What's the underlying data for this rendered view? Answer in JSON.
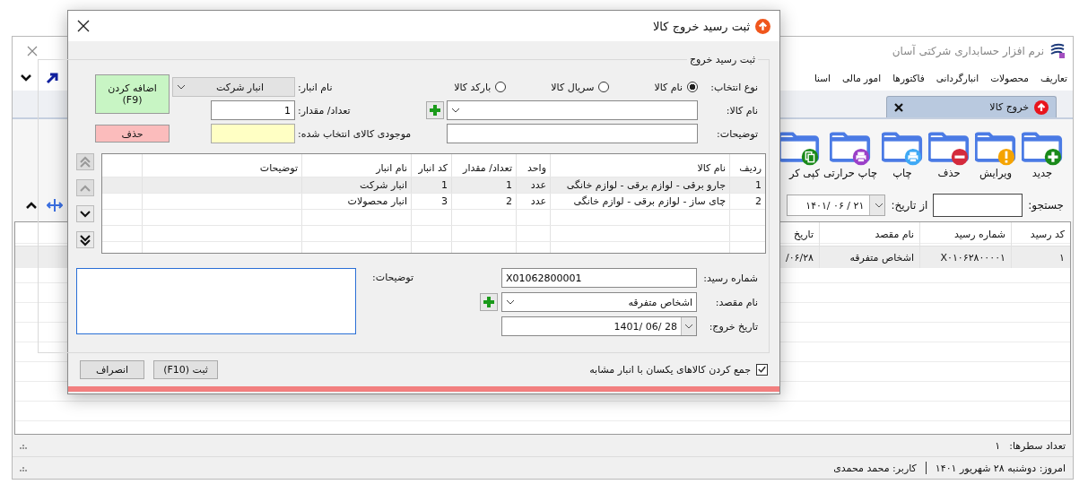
{
  "main_window": {
    "title": "نرم افزار حسابداری شرکتی آسان",
    "menu": [
      "تعاریف",
      "محصولات",
      "انبارگردانی",
      "فاکتورها",
      "امور مالی",
      "اسنا"
    ],
    "tab": {
      "label": "خروج کالا"
    },
    "toolbar": [
      {
        "label": "جدید",
        "kind": "new"
      },
      {
        "label": "ویرایش",
        "kind": "edit"
      },
      {
        "label": "حذف",
        "kind": "delete"
      },
      {
        "label": "چاپ",
        "kind": "print"
      },
      {
        "label": "چاپ حرارتی",
        "kind": "thermal"
      },
      {
        "label": "کپی کر",
        "kind": "copy"
      }
    ],
    "search": {
      "label": "جستجو:"
    },
    "from_date": {
      "label": "از تاریخ:",
      "value": "۱۴۰۱/ ۰۶ / ۲۱"
    },
    "table": {
      "columns": [
        "کد رسید",
        "شماره رسید",
        "نام مقصد",
        "تاریخ"
      ],
      "rows": [
        {
          "selected": true,
          "cells": [
            "۱",
            "X۰۱۰۶۲۸۰۰۰۰۱",
            "اشخاص متفرقه",
            "/۰۶/۲۸"
          ]
        }
      ]
    },
    "row_count": {
      "label": "تعداد سطرها:",
      "value": "۱"
    },
    "status_bar": {
      "today": "امروز: دوشنبه ۲۸ شهریور ۱۴۰۱",
      "user": "کاربر: محمد محمدی"
    }
  },
  "dialog": {
    "title": "ثبت رسید خروج کالا",
    "group_title": "ثبت رسید خروج",
    "selection_type": {
      "label": "نوع انتخاب:",
      "options": [
        {
          "label": "نام کالا",
          "selected": true
        },
        {
          "label": "سریال کالا",
          "selected": false
        },
        {
          "label": "بارکد کالا",
          "selected": false
        }
      ]
    },
    "warehouse": {
      "label": "نام انبار:",
      "value": "انبار شرکت",
      "disabled": true
    },
    "product": {
      "label": "نام کالا:"
    },
    "quantity": {
      "label": "تعداد/ مقدار:",
      "value": "1"
    },
    "description": {
      "label": "توضیحات:"
    },
    "stock": {
      "label": "موجودی کالای انتخاب شده:"
    },
    "add_button": "اضافه کردن\n(F9)",
    "delete_button": "حذف",
    "items": {
      "columns": [
        "ردیف",
        "نام کالا",
        "واحد",
        "تعداد/ مقدار",
        "کد انبار",
        "نام انبار",
        "توضیحات"
      ],
      "rows": [
        {
          "selected": true,
          "cells": [
            "1",
            "جارو برقی - لوازم برقی - لوازم خانگی",
            "عدد",
            "1",
            "1",
            "انبار شرکت"
          ]
        },
        {
          "selected": false,
          "cells": [
            "2",
            "چای ساز - لوازم برقی - لوازم خانگی",
            "عدد",
            "2",
            "3",
            "انبار محصولات"
          ]
        }
      ]
    },
    "scroll_buttons": [
      {
        "kind": "first",
        "disabled": true
      },
      {
        "kind": "up",
        "disabled": true
      },
      {
        "kind": "down",
        "disabled": false
      },
      {
        "kind": "last",
        "disabled": false
      }
    ],
    "receipt_number": {
      "label": "شماره رسید:",
      "value": "X01062800001"
    },
    "destination": {
      "label": "نام مقصد:",
      "value": "اشخاص متفرقه"
    },
    "exit_date": {
      "label": "تاریخ خروج:",
      "value": "1401/ 06/ 28"
    },
    "notes": {
      "label": "توضیحات:"
    },
    "merge": {
      "label": "جمع کردن کالاهای یکسان با انبار مشابه",
      "checked": true
    },
    "buttons": [
      "ثبت (F10)",
      "انصراف"
    ]
  }
}
